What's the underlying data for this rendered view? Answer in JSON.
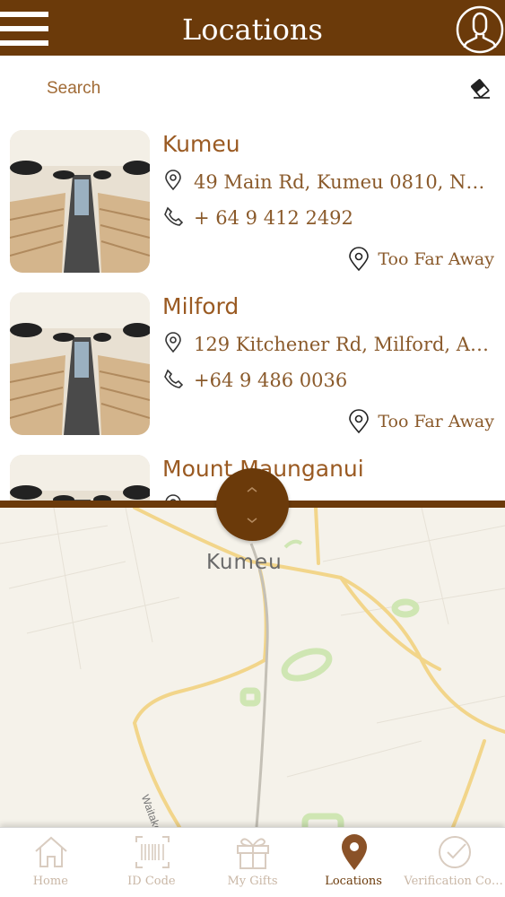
{
  "header": {
    "title": "Locations"
  },
  "search": {
    "placeholder": "Search"
  },
  "locations": [
    {
      "name": "Kumeu",
      "address": "49 Main Rd, Kumeu 0810, Ne…",
      "phone": "+ 64 9 412 2492",
      "distance": "Too Far Away"
    },
    {
      "name": "Milford",
      "address": "129 Kitchener Rd, Milford, Au…",
      "phone": "+64 9 486 0036",
      "distance": "Too Far Away"
    },
    {
      "name": "Mount Maunganui"
    }
  ],
  "map": {
    "place_label": "Kumeu",
    "road_label": "Waitakere"
  },
  "tabs": [
    {
      "label": "Home",
      "icon": "home-icon"
    },
    {
      "label": "ID Code",
      "icon": "barcode-icon"
    },
    {
      "label": "My Gifts",
      "icon": "gift-icon"
    },
    {
      "label": "Locations",
      "icon": "location-pin-icon",
      "active": true
    },
    {
      "label": "Verification Cod…",
      "icon": "check-circle-icon"
    }
  ],
  "colors": {
    "brand": "#6b3a0a",
    "text": "#8a5a2b",
    "inactive_tab": "#c9b7a6"
  }
}
